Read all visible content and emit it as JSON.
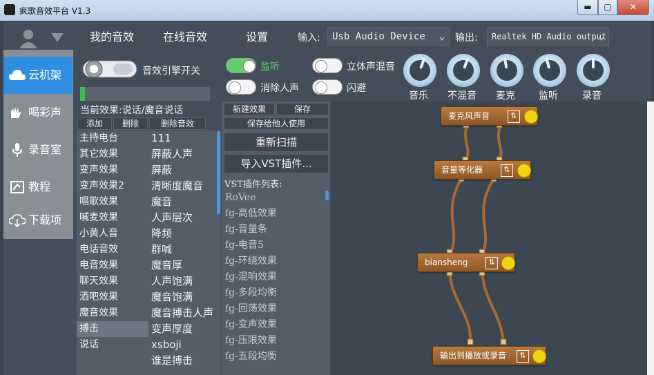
{
  "window": {
    "title": "疯歌音效平台 V1.3",
    "min": "▬",
    "max": "▢",
    "close": "✕"
  },
  "topnav": {
    "tabs": [
      "我的音效",
      "在线音效",
      "设置"
    ]
  },
  "io": {
    "input_label": "输入:",
    "input_device": "Usb Audio Device",
    "output_label": "输出:",
    "output_device": "Realtek HD Audio output"
  },
  "user": {
    "avatar_icon": "user-icon",
    "dropdown_icon": "triangle-down-icon"
  },
  "leftnav": [
    {
      "label": "云机架",
      "icon": "cloud-icon"
    },
    {
      "label": "喝彩声",
      "icon": "clap-icon"
    },
    {
      "label": "录音室",
      "icon": "microphone-icon"
    },
    {
      "label": "教程",
      "icon": "tutorial-icon"
    },
    {
      "label": "下载项",
      "icon": "download-cloud-icon"
    }
  ],
  "engine": {
    "label": "音效引擎开关"
  },
  "toggles": [
    {
      "label": "监听",
      "on": true
    },
    {
      "label": "消除人声",
      "on": false
    },
    {
      "label": "立体声混音",
      "on": false
    },
    {
      "label": "闪避",
      "on": false
    }
  ],
  "knobs": [
    "音乐",
    "不混音",
    "麦克",
    "监听",
    "录音"
  ],
  "current_effect": {
    "label": "当前效果:说话/魔音说话"
  },
  "effect_buttons": [
    "添加",
    "删除",
    "删除音效"
  ],
  "categories": [
    "主持电台",
    "其它效果",
    "变声效果",
    "变声效果2",
    "唱歌效果",
    "喊麦效果",
    "小黄人音",
    "电话音效",
    "电音效果",
    "聊天效果",
    "酒吧效果",
    "魔音效果",
    "搏击",
    "说话"
  ],
  "selected_category": "搏击",
  "effects": [
    "111",
    "屏蔽人声",
    "屏蔽",
    "清晰度魔音",
    "魔音",
    "人声层次",
    "降频",
    "群喊",
    "魔音厚",
    "人声饱满",
    "魔音饱满",
    "魔音搏击人声",
    "变声厚度",
    "xsboji",
    "谁是搏击"
  ],
  "vst": {
    "new_effect": "新建效果",
    "save": "保存",
    "save_share": "保存给他人使用",
    "rescan": "重新扫描",
    "import": "导入VST插件...",
    "list_label": "VST插件列表:",
    "plugins": [
      "RoVee",
      "fg-高低效果",
      "fg-音量条",
      "fg-电音5",
      "fg-环绕效果",
      "fg-混响效果",
      "fg-多段均衡",
      "fg-回荡效果",
      "fg-变声效果",
      "fg-压限效果",
      "fg-五段均衡"
    ]
  },
  "graph": {
    "nodes": [
      "麦克风声音",
      "音量等化器",
      "biansheng",
      "输出到播放或录音"
    ],
    "mix_icon": "mixer-icon",
    "status_icon": "status-dot-icon"
  },
  "colors": {
    "accent": "#2f8ee0",
    "node": "#a86a32",
    "toggle_on": "#5fd16a",
    "status_dot": "#f1d515"
  }
}
